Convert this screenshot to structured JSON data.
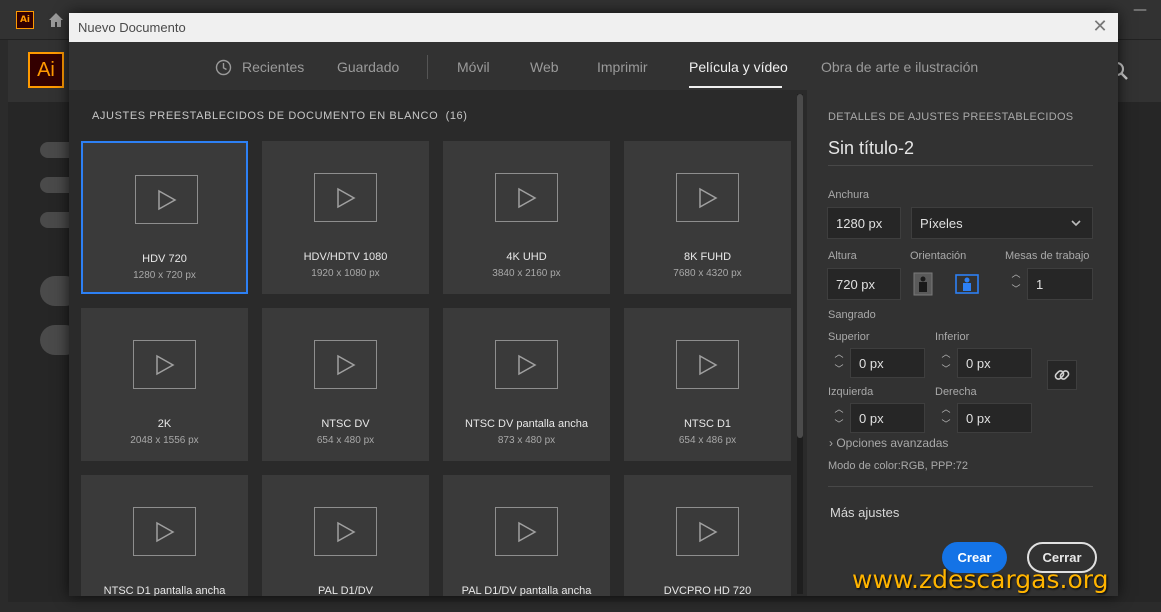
{
  "app": {
    "small_icon_label": "Ai",
    "logo_label": "Ai",
    "minimize_glyph": "—"
  },
  "dialog": {
    "title": "Nuevo Documento",
    "close_glyph": "✕"
  },
  "tabs": [
    {
      "label": "Recientes",
      "active": false
    },
    {
      "label": "Guardado",
      "active": false
    },
    {
      "label": "Móvil",
      "active": false
    },
    {
      "label": "Web",
      "active": false
    },
    {
      "label": "Imprimir",
      "active": false
    },
    {
      "label": "Película y vídeo",
      "active": true
    },
    {
      "label": "Obra de arte e ilustración",
      "active": false
    }
  ],
  "presets": {
    "header": "AJUSTES PREESTABLECIDOS DE DOCUMENTO EN BLANCO",
    "count": "(16)",
    "items": [
      {
        "name": "HDV 720",
        "dims": "1280 x 720 px",
        "selected": true
      },
      {
        "name": "HDV/HDTV 1080",
        "dims": "1920 x 1080 px",
        "selected": false
      },
      {
        "name": "4K UHD",
        "dims": "3840 x 2160 px",
        "selected": false
      },
      {
        "name": "8K FUHD",
        "dims": "7680 x 4320 px",
        "selected": false
      },
      {
        "name": "2K",
        "dims": "2048 x 1556 px",
        "selected": false
      },
      {
        "name": "NTSC DV",
        "dims": "654 x 480 px",
        "selected": false
      },
      {
        "name": "NTSC DV pantalla ancha",
        "dims": "873 x 480 px",
        "selected": false
      },
      {
        "name": "NTSC D1",
        "dims": "654 x 486 px",
        "selected": false
      },
      {
        "name": "NTSC D1 pantalla ancha",
        "dims": "",
        "selected": false
      },
      {
        "name": "PAL D1/DV",
        "dims": "",
        "selected": false
      },
      {
        "name": "PAL D1/DV pantalla ancha",
        "dims": "",
        "selected": false
      },
      {
        "name": "DVCPRO HD 720",
        "dims": "",
        "selected": false
      }
    ]
  },
  "details": {
    "header": "DETALLES DE AJUSTES PREESTABLECIDOS",
    "doc_name": "Sin título-2",
    "width_label": "Anchura",
    "width_value": "1280 px",
    "units_value": "Píxeles",
    "height_label": "Altura",
    "height_value": "720 px",
    "orientation_label": "Orientación",
    "artboards_label": "Mesas de trabajo",
    "artboards_value": "1",
    "bleed_label": "Sangrado",
    "top_label": "Superior",
    "top_value": "0 px",
    "bottom_label": "Inferior",
    "bottom_value": "0 px",
    "left_label": "Izquierda",
    "left_value": "0 px",
    "right_label": "Derecha",
    "right_value": "0 px",
    "advanced_label": "Opciones avanzadas",
    "color_mode": "Modo de color:RGB, PPP:72",
    "more_settings": "Más ajustes",
    "create_label": "Crear",
    "close_label": "Cerrar"
  },
  "watermark": "www.zdescargas.org",
  "colors": {
    "accent": "#1473e6",
    "selected_border": "#2d80f4",
    "ai_orange": "#ff9a00"
  }
}
